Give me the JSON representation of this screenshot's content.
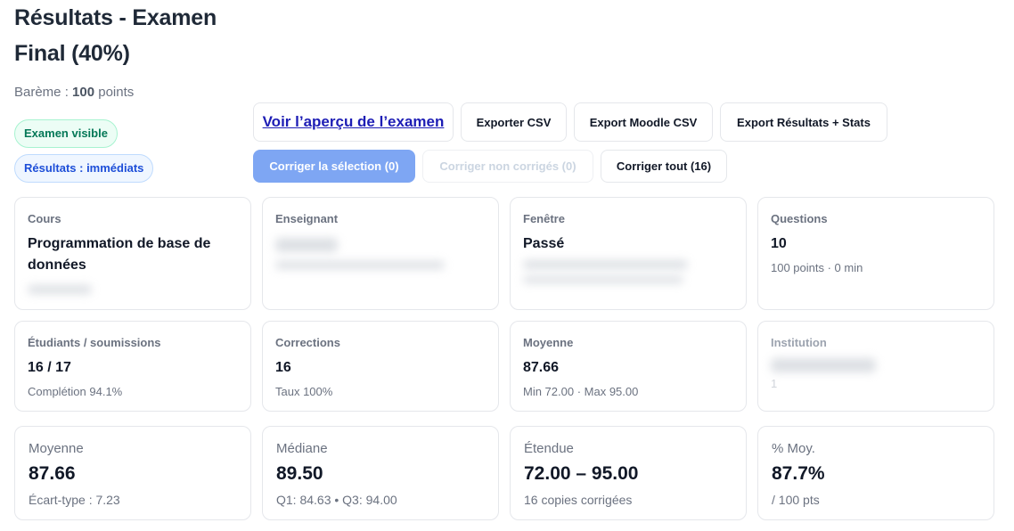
{
  "header": {
    "title": "Résultats - Examen Final (40%)",
    "scale_label": "Barème :",
    "scale_value": "100",
    "scale_unit": "points"
  },
  "badges": {
    "visible": "Examen visible",
    "results": "Résultats : immédiats"
  },
  "actions": {
    "preview": "Voir l’aperçu de l’examen",
    "export_csv": "Exporter CSV",
    "export_moodle": "Export Moodle CSV",
    "export_stats": "Export Résultats + Stats",
    "correct_selection": "Corriger la sélection (0)",
    "correct_uncorrected": "Corriger non corrigés (0)",
    "correct_all": "Corriger tout (16)"
  },
  "cards_row1": {
    "course_label": "Cours",
    "course_value": "Programmation de base de données",
    "teacher_label": "Enseignant",
    "window_label": "Fenêtre",
    "window_value": "Passé",
    "questions_label": "Questions",
    "questions_value": "10",
    "questions_sub": "100 points · 0 min"
  },
  "cards_row2": {
    "students_label": "Étudiants / soumissions",
    "students_value": "16 / 17",
    "students_sub": "Complétion 94.1%",
    "corrections_label": "Corrections",
    "corrections_value": "16",
    "corrections_sub": "Taux 100%",
    "average_label": "Moyenne",
    "average_value": "87.66",
    "average_sub": "Min 72.00 · Max 95.00",
    "institution_label": "Institution",
    "institution_sub": "1"
  },
  "stats": {
    "mean_label": "Moyenne",
    "mean_value": "87.66",
    "mean_sub": "Écart-type : 7.23",
    "median_label": "Médiane",
    "median_value": "89.50",
    "median_sub": "Q1: 84.63 • Q3: 94.00",
    "range_label": "Étendue",
    "range_value": "72.00 – 95.00",
    "range_sub": "16 copies corrigées",
    "pct_label": "% Moy.",
    "pct_value": "87.7%",
    "pct_sub": "/ 100 pts"
  }
}
